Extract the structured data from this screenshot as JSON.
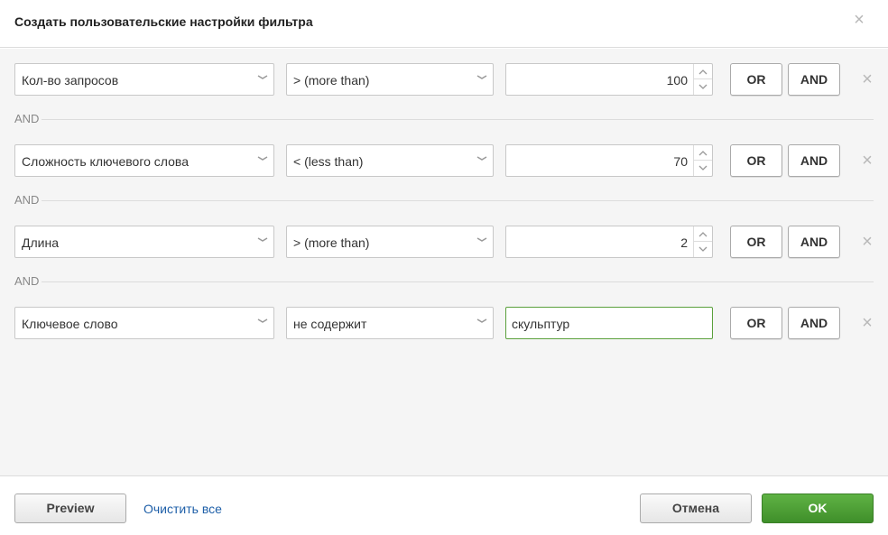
{
  "dialog": {
    "title": "Создать пользовательские настройки фильтра",
    "close_icon": "close-icon"
  },
  "rows": [
    {
      "field": "Кол-во запросов",
      "operator": "> (more than)",
      "value": "100",
      "input_type": "number",
      "or_label": "OR",
      "and_label": "AND"
    },
    {
      "field": "Сложность ключевого слова",
      "operator": "< (less than)",
      "value": "70",
      "input_type": "number",
      "or_label": "OR",
      "and_label": "AND"
    },
    {
      "field": "Длина",
      "operator": "> (more than)",
      "value": "2",
      "input_type": "number",
      "or_label": "OR",
      "and_label": "AND"
    },
    {
      "field": "Ключевое слово",
      "operator": "не содержит",
      "value": "скульптур",
      "input_type": "text",
      "or_label": "OR",
      "and_label": "AND"
    }
  ],
  "separators": [
    "AND",
    "AND",
    "AND"
  ],
  "footer": {
    "preview_label": "Preview",
    "clear_label": "Очистить все",
    "cancel_label": "Отмена",
    "ok_label": "OK"
  },
  "colors": {
    "ok_button": "#4a9e34",
    "active_input_border": "#5aa03c",
    "link": "#1e5fa8"
  }
}
